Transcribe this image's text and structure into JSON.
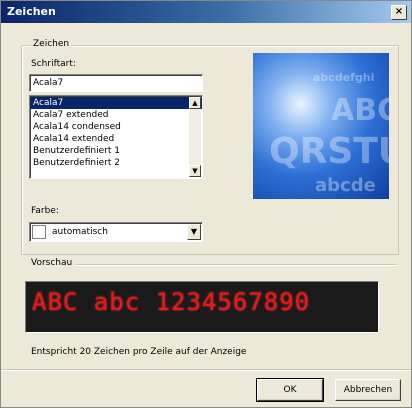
{
  "window": {
    "title": "Zeichen",
    "close_glyph": "×"
  },
  "group": {
    "legend": "Zeichen"
  },
  "font": {
    "label": "Schriftart:",
    "value": "Acala7",
    "options": [
      "Acala7",
      "Acala7 extended",
      "Acala14 condensed",
      "Acala14 extended",
      "Benutzerdefiniert 1",
      "Benutzerdefiniert 2"
    ],
    "selected_index": 0
  },
  "preview_image": {
    "lines": [
      "abcdefghi",
      "ABC",
      "QRSTU",
      "abcde"
    ]
  },
  "color": {
    "label": "Farbe:",
    "value": "automatisch"
  },
  "preview": {
    "label": "Vorschau",
    "display_text": "ABC abc 1234567890",
    "display_color": "#e11b1b"
  },
  "info_text": "Entspricht 20 Zeichen pro Zeile auf der Anzeige",
  "buttons": {
    "ok": "OK",
    "cancel": "Abbrechen"
  }
}
